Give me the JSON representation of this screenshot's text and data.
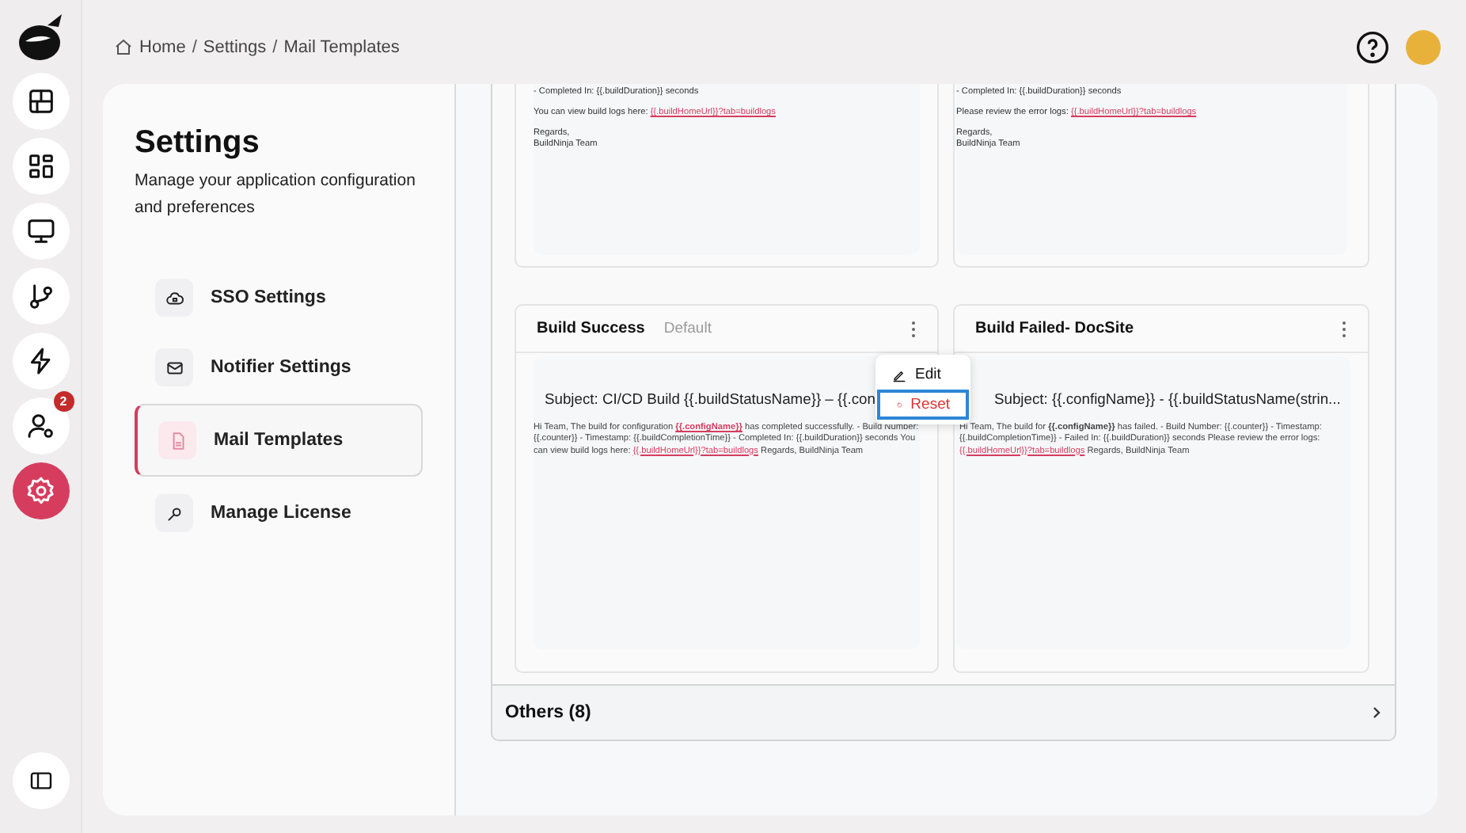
{
  "rail": {
    "items": [
      {
        "selected": false
      },
      {
        "selected": false
      },
      {
        "selected": false
      },
      {
        "selected": false
      },
      {
        "selected": false
      },
      {
        "selected": false,
        "badge": "2"
      },
      {
        "selected": true
      }
    ]
  },
  "breadcrumbs": [
    {
      "kind": "link",
      "text": "Home"
    },
    {
      "kind": "separator",
      "text": "/"
    },
    {
      "kind": "link",
      "text": "Settings"
    },
    {
      "kind": "separator",
      "text": "/"
    },
    {
      "kind": "link",
      "text": "Mail Templates"
    }
  ],
  "settings": {
    "title": "Settings",
    "description": "Manage your application configuration and preferences",
    "items": [
      {
        "label": "SSO Settings",
        "selected": false
      },
      {
        "label": "Notifier Settings",
        "selected": false
      },
      {
        "label": "Mail Templates",
        "selected": true
      },
      {
        "label": "Manage License",
        "selected": false
      }
    ]
  },
  "top_cards": [
    {
      "paragraphs": [
        [
          [
            {
              "kind": "text",
              "text": "- Completed In: {{.buildDuration}} seconds"
            }
          ]
        ],
        [
          [
            {
              "kind": "text",
              "text": "You can view build logs here: "
            },
            {
              "kind": "link",
              "text": "{{.buildHomeUrl}}?tab=buildlogs"
            }
          ]
        ],
        [
          [
            {
              "kind": "text",
              "text": "Regards,"
            }
          ],
          [
            {
              "kind": "text",
              "text": "BuildNinja Team"
            }
          ]
        ]
      ]
    },
    {
      "paragraphs": [
        [
          [
            {
              "kind": "text",
              "text": "- Completed In: {{.buildDuration}} seconds"
            }
          ]
        ],
        [
          [
            {
              "kind": "text",
              "text": "Please review the error logs: "
            },
            {
              "kind": "link",
              "text": "{{.buildHomeUrl}}?tab=buildlogs"
            }
          ]
        ],
        [
          [
            {
              "kind": "text",
              "text": "Regards,"
            }
          ],
          [
            {
              "kind": "text",
              "text": "BuildNinja Team"
            }
          ]
        ]
      ]
    }
  ],
  "cards": [
    {
      "title": "Build Success",
      "tag": "Default",
      "subject": "Subject: CI/CD Build {{.buildStatusName}} – {{.con",
      "body": [
        {
          "kind": "text",
          "text": "Hi Team, The build for configuration "
        },
        {
          "kind": "link-var",
          "text": "{{.configName}}"
        },
        {
          "kind": "text",
          "text": " has completed successfully. - Build Number: {{.counter}} - Timestamp: {{.buildCompletionTime}} - Completed In: {{.buildDuration}} seconds You can view build logs here: "
        },
        {
          "kind": "link",
          "text": "{{.buildHomeUrl}}?tab=buildlogs"
        },
        {
          "kind": "text",
          "text": " Regards, BuildNinja Team"
        }
      ],
      "menu": [
        {
          "label": "Edit",
          "selected": false
        },
        {
          "label": "Reset",
          "selected": true
        }
      ]
    },
    {
      "title": "Build Failed- DocSite",
      "subject": "Subject: {{.configName}} - {{.buildStatusName(strin...",
      "body": [
        {
          "kind": "text",
          "text": "Hi Team, The build for "
        },
        {
          "kind": "bold",
          "text": "{{.configName}}"
        },
        {
          "kind": "text",
          "text": " has failed. - Build Number: {{.counter}} - Timestamp: {{.buildCompletionTime}} - Failed In: {{.buildDuration}} seconds Please review the error logs: "
        },
        {
          "kind": "link",
          "text": "{{.buildHomeUrl}}?tab=buildlogs"
        },
        {
          "kind": "text",
          "text": " Regards, BuildNinja Team"
        }
      ]
    }
  ],
  "others": {
    "label": "Others (8)",
    "expanded": false
  }
}
